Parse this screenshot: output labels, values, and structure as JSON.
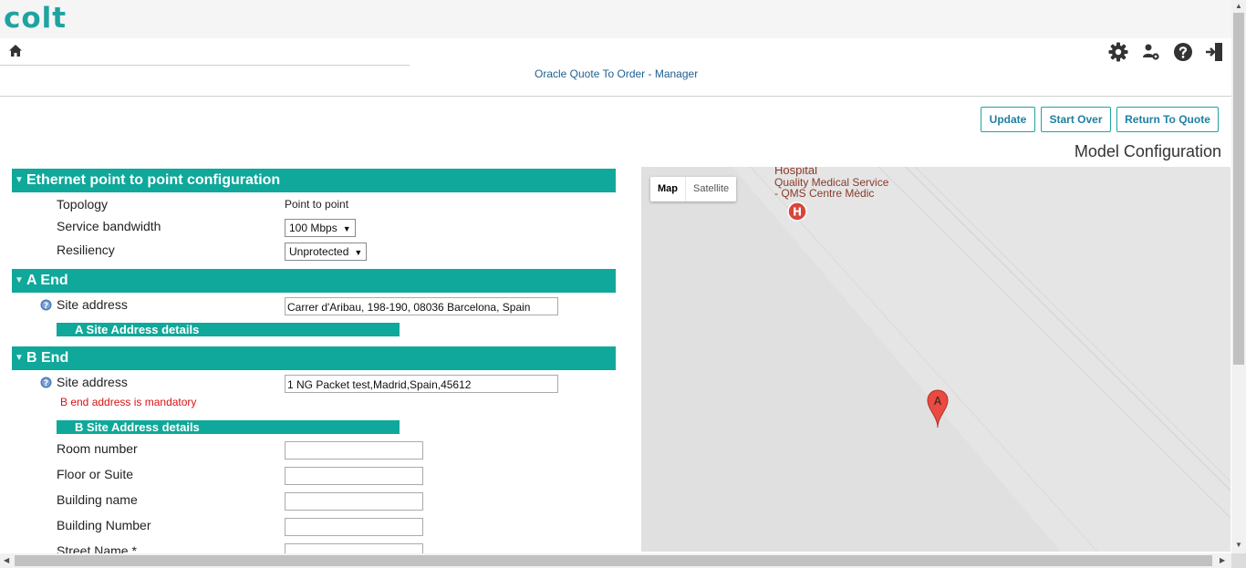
{
  "brand": {
    "logo_text": "colt",
    "accent": "#0fa89a"
  },
  "header": {
    "app_title": "Oracle Quote To Order - Manager",
    "icons": [
      "home-icon",
      "gear-icon",
      "user-settings-icon",
      "help-icon",
      "logout-icon"
    ]
  },
  "actions": {
    "update": "Update",
    "start_over": "Start Over",
    "return_to_quote": "Return To Quote"
  },
  "page_title": "Model Configuration",
  "sections": {
    "ethernet": {
      "title": "Ethernet point to point configuration",
      "topology_label": "Topology",
      "topology_value": "Point to point",
      "bandwidth_label": "Service bandwidth",
      "bandwidth_value": "100 Mbps",
      "resiliency_label": "Resiliency",
      "resiliency_value": "Unprotected"
    },
    "a_end": {
      "title": "A End",
      "site_address_label": "Site address",
      "site_address_value": "Carrer d'Aribau, 198-190, 08036 Barcelona, Spain",
      "details_title": "A Site Address details"
    },
    "b_end": {
      "title": "B End",
      "site_address_label": "Site address",
      "site_address_value": "1 NG Packet test,Madrid,Spain,45612",
      "error": "B end address is mandatory",
      "details_title": "B Site Address details",
      "room_number_label": "Room number",
      "floor_label": "Floor or Suite",
      "building_name_label": "Building name",
      "building_number_label": "Building Number",
      "street_name_label": "Street Name *"
    }
  },
  "map": {
    "map_tab": "Map",
    "satellite_tab": "Satellite",
    "poi_line1": "Hospital",
    "poi_line2": "Quality Medical Service",
    "poi_line3": "- QMS Centre Mèdic",
    "poi_marker": "H",
    "marker_label": "A"
  }
}
